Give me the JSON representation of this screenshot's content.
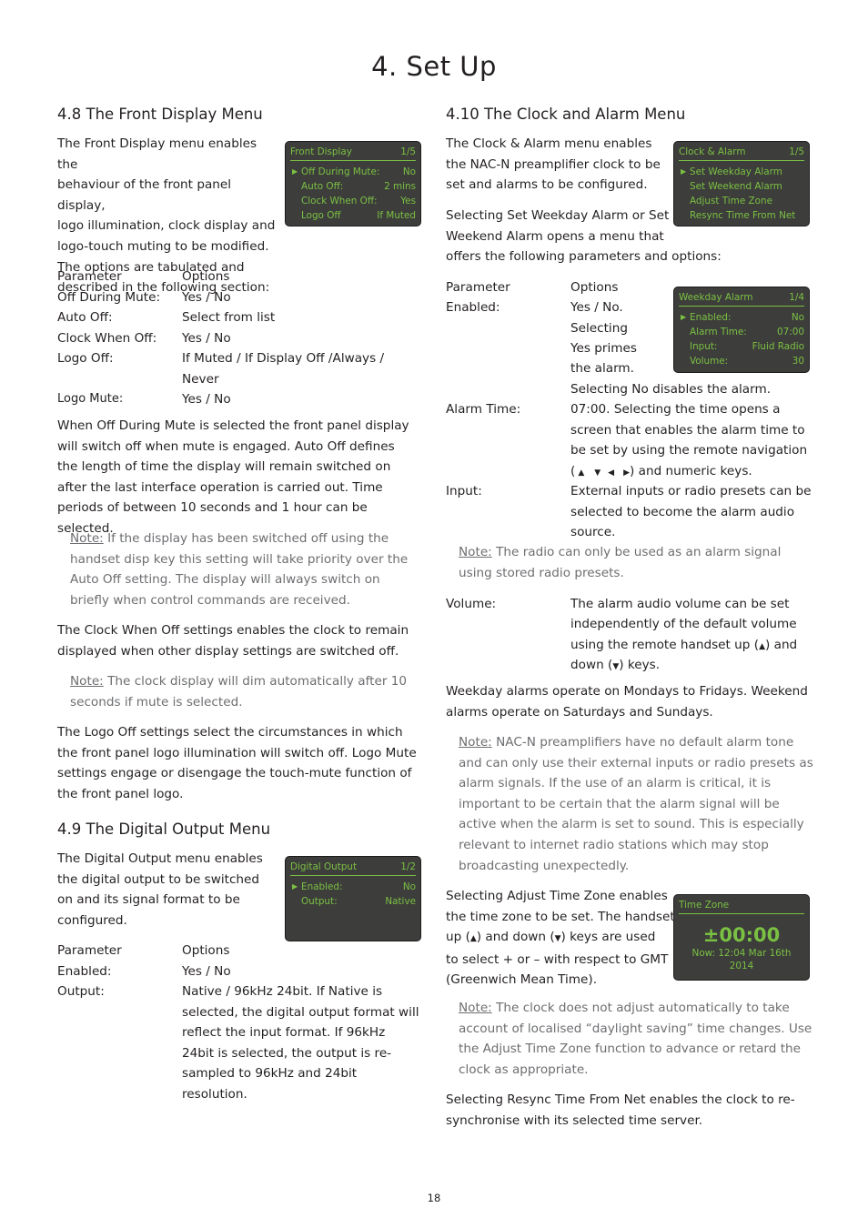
{
  "page": {
    "title": "4. Set Up",
    "page_number": "18"
  },
  "s48": {
    "heading": "4.8 The Front Display Menu",
    "intro": [
      "The Front Display menu enables the",
      "behaviour of the front panel display,",
      "logo illumination, clock display and",
      "logo-touch muting to be modified.",
      "The options are tabulated and",
      "described in the following section:"
    ],
    "table_header": {
      "param": "Parameter",
      "options": "Options"
    },
    "rows": [
      {
        "param": "Off During Mute:",
        "options": "Yes / No"
      },
      {
        "param": "Auto Off:",
        "options": "Select from list"
      },
      {
        "param": "Clock When Off:",
        "options": "Yes / No"
      },
      {
        "param": "Logo Off:",
        "options": "If Muted / If Display Off /Always /",
        "options2": "Never"
      },
      {
        "param": "Logo Mute:",
        "options": "Yes / No"
      }
    ],
    "para1": "When Off During Mute is selected the front panel display will switch off when mute is engaged. Auto Off defines the length of time the display will remain switched on after the last interface operation is carried out. Time periods of between 10 seconds and 1 hour can be selected.",
    "note1_label": "Note:",
    "note1": " If the display has been switched off using the handset disp key this setting will take priority over the Auto Off setting. The display will always switch on briefly when control commands are received.",
    "para2": "The Clock When Off settings enables the clock to remain displayed when other display settings are switched off.",
    "note2_label": "Note:",
    "note2": " The clock display will dim automatically after 10 seconds if mute is selected.",
    "para3": "The Logo Off settings select the circumstances in which the front panel logo illumination will switch off. Logo Mute settings engage or disengage the touch-mute function of the front panel logo.",
    "lcd": {
      "title": "Front Display",
      "page": "1/5",
      "items": [
        {
          "label": "Off During Mute:",
          "value": "No",
          "selected": true
        },
        {
          "label": "Auto Off:",
          "value": "2 mins"
        },
        {
          "label": "Clock When Off:",
          "value": "Yes"
        },
        {
          "label": "Logo Off",
          "value": "If Muted"
        }
      ]
    }
  },
  "s49": {
    "heading": "4.9 The Digital Output Menu",
    "intro": [
      "The Digital Output menu enables",
      "the digital output to be switched",
      "on and its signal format to be",
      "configured."
    ],
    "table_header": {
      "param": "Parameter",
      "options": "Options"
    },
    "rows": [
      {
        "param": "Enabled:",
        "options": "Yes / No"
      },
      {
        "param": "Output:",
        "options": "Native / 96kHz 24bit. If Native is selected, the digital output format will reflect the input format. If 96kHz 24bit is selected, the output is re-sampled to 96kHz and 24bit resolution."
      }
    ],
    "lcd": {
      "title": "Digital Output",
      "page": "1/2",
      "items": [
        {
          "label": "Enabled:",
          "value": "No",
          "selected": true
        },
        {
          "label": "Output:",
          "value": "Native"
        }
      ]
    }
  },
  "s410": {
    "heading": "4.10 The Clock and Alarm Menu",
    "intro": [
      "The Clock & Alarm menu enables",
      "the NAC-N preamplifier clock to be",
      "set and alarms to be configured."
    ],
    "intro2": [
      "Selecting Set Weekday Alarm or Set",
      "Weekend Alarm opens a menu that",
      "offers the following parameters and options:"
    ],
    "table_header": {
      "param": "Parameter",
      "options": "Options"
    },
    "enabled": {
      "param": "Enabled:",
      "lines": [
        "Yes / No.",
        "Selecting",
        "Yes primes",
        "the alarm.",
        "Selecting No disables the alarm."
      ]
    },
    "alarm_time": {
      "param": "Alarm Time:",
      "lines": [
        "07:00. Selecting the time opens a",
        "screen that enables the alarm time to",
        "be set by using the remote navigation"
      ],
      "keys_suffix": ") and numeric keys."
    },
    "input": {
      "param": "Input:",
      "lines": [
        "External inputs or radio presets can be",
        "selected to become the alarm audio",
        "source."
      ]
    },
    "note1_label": "Note:",
    "note1": " The radio can only be used as an alarm signal using stored radio presets.",
    "volume": {
      "param": "Volume:",
      "lines": [
        "The alarm audio volume can be set",
        "independently of the default volume"
      ],
      "line3a": "using the remote handset up (",
      "line3b": ") and",
      "line4a": "down (",
      "line4b": ") keys."
    },
    "para_days": "Weekday alarms operate on Mondays to Fridays. Weekend alarms operate on Saturdays and Sundays.",
    "note2_label": "Note:",
    "note2": " NAC-N preamplifiers have no default alarm tone and can only use their external inputs or radio presets as alarm signals. If the use of an alarm is critical, it is important to be certain that the alarm signal will be active when the alarm is set to sound. This is especially relevant to internet radio stations which may stop broadcasting unexpectedly.",
    "tz_lines": {
      "l1": "Selecting Adjust Time Zone enables",
      "l2": "the time zone to be set. The handset",
      "l3a": "up (",
      "l3b": ") and down (",
      "l3c": ") keys are used",
      "l4": "to select + or – with respect to GMT",
      "l5": "(Greenwich Mean Time)."
    },
    "note3_label": "Note:",
    "note3": " The clock does not adjust automatically to take account of localised “daylight saving” time changes. Use the Adjust Time Zone function to advance or retard the clock as appropriate.",
    "para_resync": "Selecting Resync Time From Net enables the clock to re-synchronise with its selected time server.",
    "lcd_clock": {
      "title": "Clock & Alarm",
      "page": "1/5",
      "items": [
        {
          "label": "Set Weekday Alarm",
          "selected": true
        },
        {
          "label": "Set Weekend Alarm"
        },
        {
          "label": "Adjust Time Zone"
        },
        {
          "label": "Resync Time From Net"
        }
      ]
    },
    "lcd_weekday": {
      "title": "Weekday Alarm",
      "page": "1/4",
      "items": [
        {
          "label": "Enabled:",
          "value": "No",
          "selected": true
        },
        {
          "label": "Alarm Time:",
          "value": "07:00"
        },
        {
          "label": "Input:",
          "value": "Fluid Radio"
        },
        {
          "label": "Volume:",
          "value": "30"
        }
      ]
    },
    "lcd_tz": {
      "title": "Time Zone",
      "offset": "±00:00",
      "now": "Now: 12:04 Mar 16th 2014"
    }
  },
  "glyphs": {
    "up": "▲",
    "down": "▼",
    "left": "◀",
    "right": "▶",
    "pointer": "▶"
  }
}
